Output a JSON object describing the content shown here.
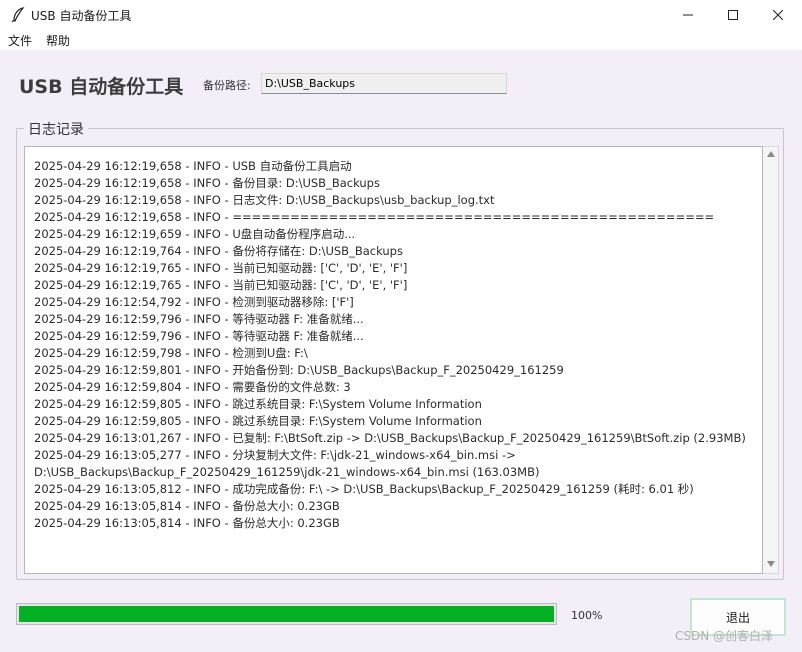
{
  "window": {
    "title": "USB 自动备份工具",
    "controls": [
      "minimize-icon",
      "maximize-icon",
      "close-icon"
    ]
  },
  "menu": {
    "items": [
      "文件",
      "帮助"
    ]
  },
  "header": {
    "title": "USB 自动备份工具",
    "path_label": "备份路径:",
    "path_value": "D:\\USB_Backups"
  },
  "log": {
    "legend": "日志记录",
    "lines": [
      "2025-04-29 16:12:19,658 - INFO - USB 自动备份工具启动",
      "2025-04-29 16:12:19,658 - INFO - 备份目录: D:\\USB_Backups",
      "2025-04-29 16:12:19,658 - INFO - 日志文件: D:\\USB_Backups\\usb_backup_log.txt",
      "2025-04-29 16:12:19,658 - INFO - ==================================================",
      "2025-04-29 16:12:19,659 - INFO - U盘自动备份程序启动...",
      "2025-04-29 16:12:19,764 - INFO - 备份将存储在: D:\\USB_Backups",
      "2025-04-29 16:12:19,765 - INFO - 当前已知驱动器: ['C', 'D', 'E', 'F']",
      "2025-04-29 16:12:19,765 - INFO - 当前已知驱动器: ['C', 'D', 'E', 'F']",
      "2025-04-29 16:12:54,792 - INFO - 检测到驱动器移除: ['F']",
      "2025-04-29 16:12:59,796 - INFO - 等待驱动器 F: 准备就绪...",
      "2025-04-29 16:12:59,796 - INFO - 等待驱动器 F: 准备就绪...",
      "2025-04-29 16:12:59,798 - INFO - 检测到U盘: F:\\",
      "2025-04-29 16:12:59,801 - INFO - 开始备份到: D:\\USB_Backups\\Backup_F_20250429_161259",
      "2025-04-29 16:12:59,804 - INFO - 需要备份的文件总数: 3",
      "2025-04-29 16:12:59,805 - INFO - 跳过系统目录: F:\\System Volume Information",
      "2025-04-29 16:12:59,805 - INFO - 跳过系统目录: F:\\System Volume Information",
      "2025-04-29 16:13:01,267 - INFO - 已复制: F:\\BtSoft.zip -> D:\\USB_Backups\\Backup_F_20250429_161259\\BtSoft.zip (2.93MB)",
      "2025-04-29 16:13:05,277 - INFO - 分块复制大文件: F:\\jdk-21_windows-x64_bin.msi ->",
      "D:\\USB_Backups\\Backup_F_20250429_161259\\jdk-21_windows-x64_bin.msi (163.03MB)",
      "2025-04-29 16:13:05,812 - INFO - 成功完成备份: F:\\ -> D:\\USB_Backups\\Backup_F_20250429_161259 (耗时: 6.01 秒)",
      "2025-04-29 16:13:05,814 - INFO - 备份总大小: 0.23GB",
      "2025-04-29 16:13:05,814 - INFO - 备份总大小: 0.23GB"
    ]
  },
  "progress": {
    "value": 1.0,
    "text": "100%",
    "color": "#06b025"
  },
  "exit_button": {
    "label": "退出"
  },
  "watermark": "CSDN @创客白泽"
}
